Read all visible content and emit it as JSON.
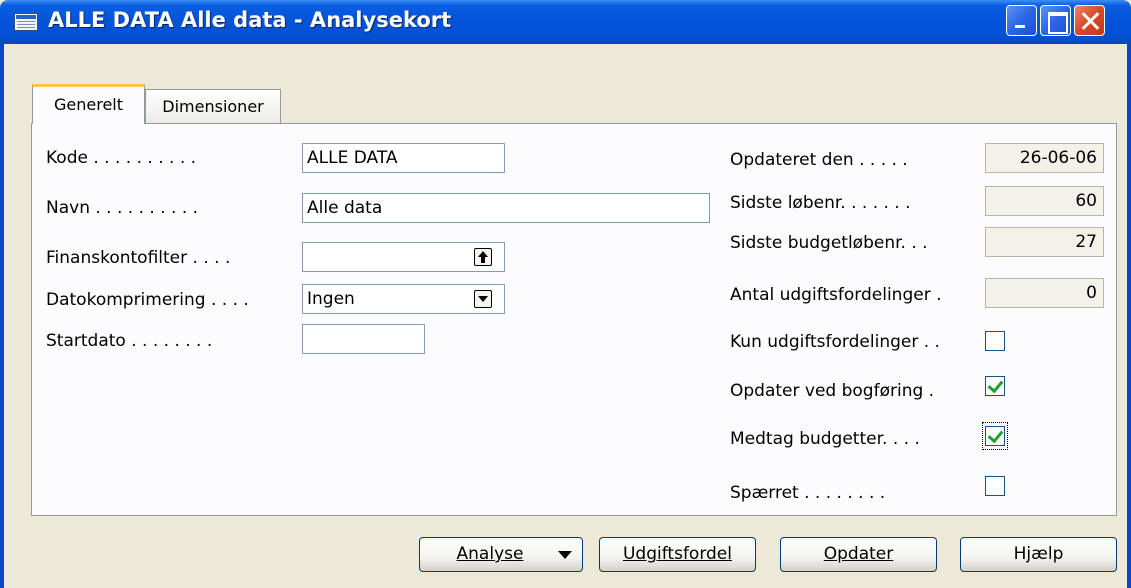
{
  "window": {
    "title": "ALLE DATA Alle data - Analysekort"
  },
  "tabs": [
    {
      "label": "Generelt",
      "active": true
    },
    {
      "label": "Dimensioner",
      "active": false
    }
  ],
  "left_fields": {
    "kode": {
      "label": "Kode . . . . . . . . . .",
      "value": "ALLE DATA"
    },
    "navn": {
      "label": "Navn . . . . . . . . . .",
      "value": "Alle data"
    },
    "finanskontofilter": {
      "label": "Finanskontofilter . . . .",
      "value": ""
    },
    "datokomprimering": {
      "label": "Datokomprimering . . . .",
      "value": "Ingen"
    },
    "startdato": {
      "label": "Startdato . . . . . . . .",
      "value": ""
    }
  },
  "right_fields": {
    "opdateret_den": {
      "label": "Opdateret den . . . . .",
      "value": "26-06-06"
    },
    "sidste_lobenr": {
      "label": "Sidste løbenr. . . . . . .",
      "value": "60"
    },
    "sidste_budgetlobenr": {
      "label": "Sidste budgetløbenr. . .",
      "value": "27"
    },
    "antal_udgiftsfordelinger": {
      "label": "Antal udgiftsfordelinger .",
      "value": "0"
    },
    "kun_udgiftsfordelinger": {
      "label": "Kun udgiftsfordelinger . .",
      "checked": false
    },
    "opdater_ved_bogforing": {
      "label": "Opdater ved bogføring .",
      "checked": true
    },
    "medtag_budgetter": {
      "label": "Medtag budgetter. . . .",
      "checked": true
    },
    "spaerret": {
      "label": "Spærret . . . . . . . .",
      "checked": false
    }
  },
  "buttons": {
    "analyse": {
      "label": "Analyse"
    },
    "udgiftsfordel": {
      "label": "Udgiftsfordel"
    },
    "opdater": {
      "label": "Opdater"
    },
    "hjaelp": {
      "label": "Hjælp"
    }
  },
  "colors": {
    "titlebar": "#0353d8",
    "tab_highlight": "#ffc83c",
    "check": "#21a121"
  }
}
